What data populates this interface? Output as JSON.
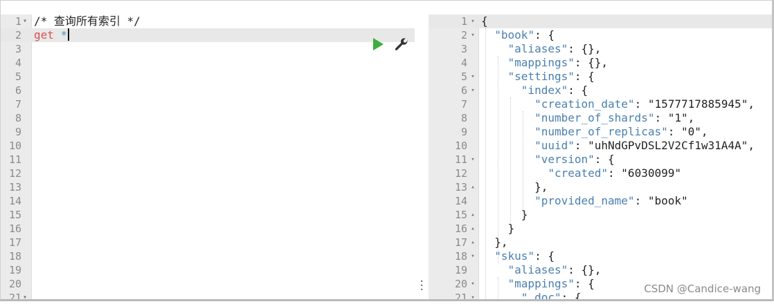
{
  "left_editor": {
    "lines": [
      {
        "num": "1",
        "fold": "▾",
        "code": "/* 查询所有索引 */"
      },
      {
        "num": "2",
        "fold": "",
        "code": ""
      },
      {
        "num": "3",
        "fold": "",
        "code": ""
      },
      {
        "num": "4",
        "fold": "",
        "code": ""
      },
      {
        "num": "5",
        "fold": "",
        "code": ""
      },
      {
        "num": "6",
        "fold": "",
        "code": ""
      },
      {
        "num": "7",
        "fold": "",
        "code": ""
      },
      {
        "num": "8",
        "fold": "",
        "code": ""
      },
      {
        "num": "9",
        "fold": "",
        "code": ""
      },
      {
        "num": "10",
        "fold": "",
        "code": ""
      },
      {
        "num": "11",
        "fold": "",
        "code": ""
      },
      {
        "num": "12",
        "fold": "",
        "code": ""
      },
      {
        "num": "13",
        "fold": "",
        "code": ""
      },
      {
        "num": "14",
        "fold": "",
        "code": ""
      },
      {
        "num": "15",
        "fold": "",
        "code": ""
      },
      {
        "num": "16",
        "fold": "",
        "code": ""
      },
      {
        "num": "17",
        "fold": "",
        "code": ""
      },
      {
        "num": "18",
        "fold": "",
        "code": ""
      },
      {
        "num": "19",
        "fold": "",
        "code": ""
      },
      {
        "num": "20",
        "fold": "",
        "code": ""
      },
      {
        "num": "21",
        "fold": "▾",
        "code": ""
      }
    ],
    "active_method": "get",
    "active_path": "*",
    "run_icon": "play-icon",
    "settings_icon": "wrench-icon"
  },
  "right_editor": {
    "lines": [
      {
        "num": "1",
        "fold": "▾",
        "code": "{"
      },
      {
        "num": "2",
        "fold": "▾",
        "code": "  \"book\": {"
      },
      {
        "num": "3",
        "fold": "",
        "code": "    \"aliases\": {},"
      },
      {
        "num": "4",
        "fold": "",
        "code": "    \"mappings\": {},"
      },
      {
        "num": "5",
        "fold": "▾",
        "code": "    \"settings\": {"
      },
      {
        "num": "6",
        "fold": "▾",
        "code": "      \"index\": {"
      },
      {
        "num": "7",
        "fold": "",
        "code": "        \"creation_date\": \"1577717885945\","
      },
      {
        "num": "8",
        "fold": "",
        "code": "        \"number_of_shards\": \"1\","
      },
      {
        "num": "9",
        "fold": "",
        "code": "        \"number_of_replicas\": \"0\","
      },
      {
        "num": "10",
        "fold": "",
        "code": "        \"uuid\": \"uhNdGPvDSL2V2Cf1w31A4A\","
      },
      {
        "num": "11",
        "fold": "▾",
        "code": "        \"version\": {"
      },
      {
        "num": "12",
        "fold": "",
        "code": "          \"created\": \"6030099\""
      },
      {
        "num": "13",
        "fold": "▴",
        "code": "        },"
      },
      {
        "num": "14",
        "fold": "",
        "code": "        \"provided_name\": \"book\""
      },
      {
        "num": "15",
        "fold": "▴",
        "code": "      }"
      },
      {
        "num": "16",
        "fold": "▴",
        "code": "    }"
      },
      {
        "num": "17",
        "fold": "▴",
        "code": "  },"
      },
      {
        "num": "18",
        "fold": "▾",
        "code": "  \"skus\": {"
      },
      {
        "num": "19",
        "fold": "",
        "code": "    \"aliases\": {},"
      },
      {
        "num": "20",
        "fold": "▾",
        "code": "    \"mappings\": {"
      },
      {
        "num": "21",
        "fold": "▾",
        "code": "      \"_doc\": {"
      }
    ]
  },
  "pane_divider_icon": "drag-handle-icon",
  "watermark": "CSDN @Candice-wang"
}
